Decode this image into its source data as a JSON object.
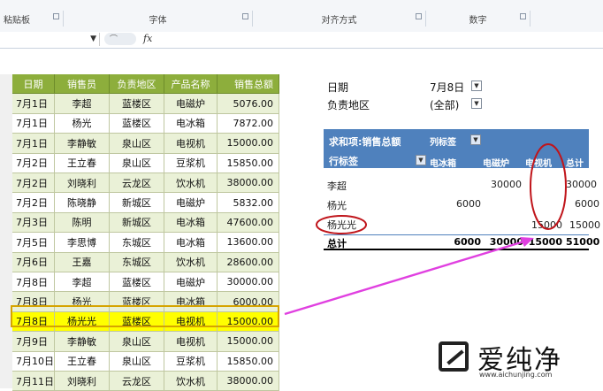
{
  "ribbon": {
    "groups": [
      "粘贴板",
      "字体",
      "对齐方式",
      "数字"
    ]
  },
  "formula_bar": {
    "fx_label": "fx"
  },
  "left_table": {
    "headers": [
      "日期",
      "销售员",
      "负责地区",
      "产品名称",
      "销售总额"
    ],
    "rows": [
      [
        "7月1日",
        "李超",
        "蓝楼区",
        "电磁炉",
        "5076.00"
      ],
      [
        "7月1日",
        "杨光",
        "蓝楼区",
        "电冰箱",
        "7872.00"
      ],
      [
        "7月1日",
        "李静敏",
        "泉山区",
        "电视机",
        "15000.00"
      ],
      [
        "7月2日",
        "王立春",
        "泉山区",
        "豆浆机",
        "15850.00"
      ],
      [
        "7月2日",
        "刘晓利",
        "云龙区",
        "饮水机",
        "38000.00"
      ],
      [
        "7月2日",
        "陈晓静",
        "新城区",
        "电磁炉",
        "5832.00"
      ],
      [
        "7月3日",
        "陈明",
        "新城区",
        "电冰箱",
        "47600.00"
      ],
      [
        "7月5日",
        "李思博",
        "东城区",
        "电冰箱",
        "13600.00"
      ],
      [
        "7月6日",
        "王嘉",
        "东城区",
        "饮水机",
        "28600.00"
      ],
      [
        "7月8日",
        "李超",
        "蓝楼区",
        "电磁炉",
        "30000.00"
      ],
      [
        "7月8日",
        "杨光",
        "蓝楼区",
        "电冰箱",
        "6000.00"
      ],
      [
        "7月8日",
        "杨光光",
        "蓝楼区",
        "电视机",
        "15000.00"
      ],
      [
        "7月9日",
        "李静敏",
        "泉山区",
        "电视机",
        "15000.00"
      ],
      [
        "7月10日",
        "王立春",
        "泉山区",
        "豆浆机",
        "15850.00"
      ],
      [
        "7月11日",
        "刘晓利",
        "云龙区",
        "饮水机",
        "38000.00"
      ]
    ],
    "highlighted_row": 11
  },
  "pivot": {
    "filters": [
      {
        "label": "日期",
        "value": "7月8日",
        "icon": "filter-funnel-icon"
      },
      {
        "label": "负责地区",
        "value": "(全部)",
        "icon": "dropdown-icon"
      }
    ],
    "header": {
      "value_field": "求和项:销售总额",
      "column_labels": "列标签",
      "row_labels": "行标签",
      "columns": [
        "电冰箱",
        "电磁炉",
        "电视机",
        "总计"
      ]
    },
    "rows": [
      {
        "label": "李超",
        "values": [
          "",
          "30000",
          "",
          "30000"
        ]
      },
      {
        "label": "杨光",
        "values": [
          "6000",
          "",
          "",
          "6000"
        ]
      },
      {
        "label": "杨光光",
        "values": [
          "",
          "",
          "15000",
          "15000"
        ]
      }
    ],
    "total": {
      "label": "总计",
      "values": [
        "6000",
        "30000",
        "15000",
        "51000"
      ]
    }
  },
  "annotation": {
    "arrow_color": "#e040e0",
    "circle_color": "#c0151b"
  },
  "watermark": {
    "name": "爱纯净",
    "url": "www.aichunjing.com"
  }
}
